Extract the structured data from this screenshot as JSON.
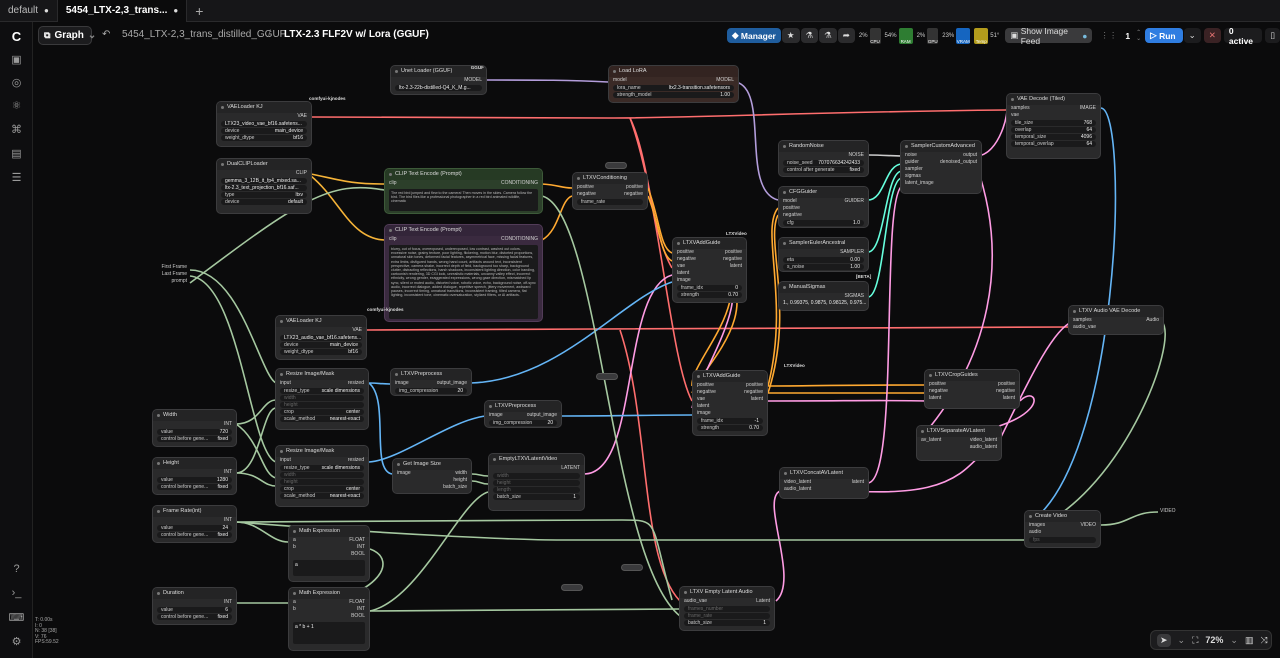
{
  "tabs": [
    {
      "label": "default",
      "dirty": true
    },
    {
      "label": "5454_LTX-2,3_trans...",
      "dirty": true,
      "active": true
    }
  ],
  "toolbar": {
    "graph_label": "Graph",
    "workflow_name": "5454_LTX-2,3_trans_distilled_GGUF",
    "separator": "/",
    "subgraph_name": "LTX-2.3 FLF2V w/ Lora (GGUF)",
    "manager_label": "Manager",
    "cpu_pct": "2%",
    "cpu_label": "CPU",
    "ram_pct": "54%",
    "ram_label": "RAM",
    "gpu_pct": "2%",
    "gpu_label": "GPU",
    "vram_pct": "23%",
    "vram_label": "VRAM",
    "temp": "51°",
    "temp_label": "Temp",
    "image_feed_label": "Show Image Feed",
    "queue_count": "1",
    "run_label": "Run",
    "active_label": "0 active"
  },
  "colors": {
    "accent": "#2f7de1",
    "manager": "#1f5d9e",
    "wire_clip": "#f5b338",
    "wire_vae": "#ff6e6e",
    "wire_model": "#b39ddb",
    "wire_latent": "#ff9ce4",
    "wire_image": "#64b5f6",
    "wire_int": "#a5c8a0",
    "wire_cond": "#ffa931"
  },
  "stats": {
    "t": "T: 0.00s",
    "i": "I: 0",
    "n": "N: 38 [38]",
    "v": "V: 76",
    "fps": "FPS:59.52"
  },
  "zoom": {
    "level": "72%"
  },
  "nodes": {
    "unet": {
      "title": "Unet Loader (GGUF)",
      "badge": "GGUF",
      "out": "MODEL",
      "w1": "ltx-2.3-22b-distilled-Q4_K_M.g..."
    },
    "lora": {
      "title": "Load LoRA",
      "in": "model",
      "out": "MODEL",
      "w1k": "lora_name",
      "w1v": "ltx2.3-transition.safetensors",
      "w2k": "strength_model",
      "w2v": "1.00"
    },
    "vae1": {
      "title": "VAELoader KJ",
      "badge": "comfyui-kjnodes",
      "out": "VAE",
      "w1": "LTX23_video_vae_bf16.safetens...",
      "w2k": "device",
      "w2v": "main_device",
      "w3k": "weight_dtype",
      "w3v": "bf16"
    },
    "dualclip": {
      "title": "DualCLIPLoader",
      "out": "CLIP",
      "w1": "gemma_3_12B_it_fp4_mixed.sa...",
      "w2": "ltx-2.3_text_projection_bf16.saf...",
      "w3k": "type",
      "w3v": "ltxv",
      "w4k": "device",
      "w4v": "default"
    },
    "clip_pos": {
      "title": "CLIP Text Encode (Prompt)",
      "in": "clip",
      "out": "CONDITIONING",
      "text": "The red bird jumped and flew to the camera! Then moves in the skies. Camera follow the bird. The bird flies like a professional photographer in a red bird animated wildlife, cinematic"
    },
    "clip_neg": {
      "title": "CLIP Text Encode (Prompt)",
      "in": "clip",
      "out": "CONDITIONING",
      "text": "blurry, out of focus, overexposed, underexposed, low contrast, washed out colors, excessive noise, grainy texture, poor lighting, flickering, motion blur, distorted proportions, unnatural skin tones, deformed facial features, asymmetrical face, missing facial features, extra limbs, disfigured hands, wrong hand count, artifacts around text, inconsistent perspective, camera shake, incorrect depth of field, background too sharp, background clutter, distracting reflections, harsh shadows, inconsistent lighting direction, color banding, cartoonish rendering, 3D CGI look, unrealistic materials, uncanny valley effect, incorrect ethnicity, wrong gender, exaggerated expressions, wrong gaze direction, mismatched lip sync, silent or muted audio, distorted voice, robotic voice, echo, background noise, off-sync audio, incorrect dialogue, added dialogue, repetitive speech, jittery movement, awkward pauses, incorrect timing, unnatural transitions, inconsistent framing, tilted camera, flat lighting, inconsistent tone, cinematic oversaturation, stylized filters, or AI artifacts."
    },
    "ltxvcond": {
      "title": "LTXVConditioning",
      "in1": "positive",
      "in2": "negative",
      "w1": "frame_rate",
      "out1": "positive",
      "out2": "negative"
    },
    "addguide1": {
      "title": "LTXVAddGuide",
      "badge": "LTXVideo",
      "ins": [
        "positive",
        "negative",
        "vae",
        "latent",
        "image"
      ],
      "outs": [
        "positive",
        "negative",
        "latent"
      ],
      "w1k": "frame_idx",
      "w1v": "0",
      "w2k": "strength",
      "w2v": "0.70"
    },
    "addguide2": {
      "title": "LTXVAddGuide",
      "badge": "LTXVideo",
      "ins": [
        "positive",
        "negative",
        "vae",
        "latent",
        "image"
      ],
      "outs": [
        "positive",
        "negative",
        "latent"
      ],
      "w1k": "frame_idx",
      "w1v": "-1",
      "w2k": "strength",
      "w2v": "0.70"
    },
    "randnoise": {
      "title": "RandomNoise",
      "out": "NOISE",
      "w1k": "noise_seed",
      "w1v": "707076634242433",
      "w2k": "control after generate",
      "w2v": "fixed"
    },
    "cfgguider": {
      "title": "CFGGuider",
      "ins": [
        "model",
        "positive",
        "negative"
      ],
      "out": "GUIDER",
      "w1k": "cfg",
      "w1v": "1.0"
    },
    "sampler_sel": {
      "title": "SamplerEulerAncestral",
      "out": "SAMPLER",
      "w1k": "eta",
      "w1v": "0.00",
      "w2k": "s_noise",
      "w2v": "1.00"
    },
    "manualsigmas": {
      "title": "ManualSigmas",
      "badge": "[BETA]",
      "out": "SIGMAS",
      "w1": "1., 0.99375, 0.9875, 0.98125, 0.975..."
    },
    "samplercustom": {
      "title": "SamplerCustomAdvanced",
      "ins": [
        "noise",
        "guider",
        "sampler",
        "sigmas",
        "latent_image"
      ],
      "outs": [
        "output",
        "denoised_output"
      ]
    },
    "vaedecode": {
      "title": "VAE Decode (Tiled)",
      "ins": [
        "samples",
        "vae"
      ],
      "out": "IMAGE",
      "w1k": "tile_size",
      "w1v": "768",
      "w2k": "overlap",
      "w2v": "64",
      "w3k": "temporal_size",
      "w3v": "4096",
      "w4k": "temporal_overlap",
      "w4v": "64"
    },
    "audiovae": {
      "title": "LTXV Audio VAE Decode",
      "ins": [
        "samples",
        "audio_vae"
      ],
      "out": "Audio"
    },
    "vae2": {
      "title": "VAELoader KJ",
      "badge": "comfyui-kjnodes",
      "out": "VAE",
      "w1": "LTX23_audio_vae_bf16.safetens...",
      "w2k": "device",
      "w2v": "main_device",
      "w3k": "weight_dtype",
      "w3v": "bf16"
    },
    "preprocess1": {
      "title": "LTXVPreprocess",
      "in": "image",
      "out": "output_image",
      "w1k": "img_compression",
      "w1v": "20"
    },
    "preprocess2": {
      "title": "LTXVPreprocess",
      "in": "image",
      "out": "output_image",
      "w1k": "img_compression",
      "w1v": "20"
    },
    "resize1": {
      "title": "Resize Image/Mask",
      "in": "input",
      "out": "resized",
      "w1k": "resize_type",
      "w1v": "scale dimensions",
      "w2": "width",
      "w3": "height",
      "w4k": "crop",
      "w4v": "center",
      "w5k": "scale_method",
      "w5v": "nearest-exact"
    },
    "resize2": {
      "title": "Resize Image/Mask",
      "in": "input",
      "out": "resized",
      "w1k": "resize_type",
      "w1v": "scale dimensions",
      "w2": "width",
      "w3": "height",
      "w4k": "crop",
      "w4v": "center",
      "w5k": "scale_method",
      "w5v": "nearest-exact"
    },
    "getsize": {
      "title": "Get Image Size",
      "in": "image",
      "outs": [
        "width",
        "height",
        "batch_size"
      ]
    },
    "emptylatent": {
      "title": "EmptyLTXVLatentVideo",
      "out": "LATENT",
      "ins": [
        "width",
        "height",
        "length"
      ],
      "w1k": "batch_size",
      "w1v": "1"
    },
    "cropguides": {
      "title": "LTXVCropGuides",
      "ins": [
        "positive",
        "negative",
        "latent"
      ],
      "outs": [
        "positive",
        "negative",
        "latent"
      ]
    },
    "separate": {
      "title": "LTXVSeparateAVLatent",
      "in": "av_latent",
      "outs": [
        "video_latent",
        "audio_latent"
      ]
    },
    "concat": {
      "title": "LTXVConcatAVLatent",
      "ins": [
        "video_latent",
        "audio_latent"
      ],
      "out": "latent"
    },
    "createvideo": {
      "title": "Create Video",
      "ins": [
        "images",
        "audio",
        "fps"
      ],
      "out": "VIDEO"
    },
    "audiolatent": {
      "title": "LTXV Empty Latent Audio",
      "ins": [
        "audio_vae",
        "frames_number",
        "frame_rate"
      ],
      "out": "Latent",
      "w1k": "batch_size",
      "w1v": "1"
    },
    "width": {
      "title": "Width",
      "out": "INT",
      "w1k": "value",
      "w1v": "720",
      "w2k": "control before gene...",
      "w2v": "fixed"
    },
    "height": {
      "title": "Height",
      "out": "INT",
      "w1k": "value",
      "w1v": "1280",
      "w2k": "control before gene...",
      "w2v": "fixed"
    },
    "framerate": {
      "title": "Frame Rate(int)",
      "out": "INT",
      "w1k": "value",
      "w1v": "24",
      "w2k": "control before gene...",
      "w2v": "fixed"
    },
    "duration": {
      "title": "Duration",
      "out": "INT",
      "w1k": "value",
      "w1v": "6",
      "w2k": "control before gene...",
      "w2v": "fixed"
    },
    "math1": {
      "title": "Math Expression",
      "ins": [
        "a",
        "b"
      ],
      "outs": [
        "FLOAT",
        "INT",
        "BOOL"
      ],
      "expr": "a"
    },
    "math2": {
      "title": "Math Expression",
      "ins": [
        "a",
        "b"
      ],
      "outs": [
        "FLOAT",
        "INT",
        "BOOL"
      ],
      "expr": "a * b + 1"
    },
    "inputs": {
      "labels": [
        "First Frame",
        "Last Frame",
        "prompt"
      ]
    },
    "output": {
      "label": "VIDEO"
    }
  }
}
